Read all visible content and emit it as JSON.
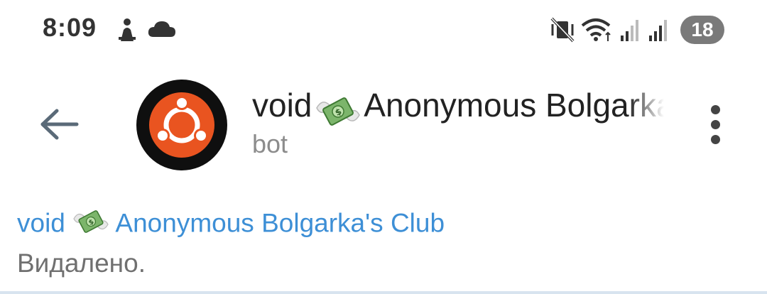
{
  "status_bar": {
    "time": "8:09",
    "left_icons": [
      "sleeping-person-icon",
      "cloud-icon"
    ],
    "right_icons": [
      "muted-vibrate-icon",
      "wifi-icon",
      "signal-icon",
      "signal-icon"
    ],
    "battery": "18"
  },
  "header": {
    "back_icon": "arrow-left-icon",
    "avatar_icon": "ubuntu-logo",
    "avatar_colors": {
      "background": "#0f0f0f",
      "circle": "#e95420"
    },
    "title_prefix": "void",
    "title_emoji": "money-with-wings-icon",
    "title_suffix": "Anonymous Bolgarka's Club",
    "subtitle": "bot",
    "menu_icon": "more-vertical-icon"
  },
  "message": {
    "title_prefix": "void",
    "title_emoji": "money-with-wings-icon",
    "title_suffix": "Anonymous Bolgarka's Club",
    "text": "Видалено."
  },
  "colors": {
    "accent": "#3d8fd6",
    "muted_text": "#707070"
  }
}
